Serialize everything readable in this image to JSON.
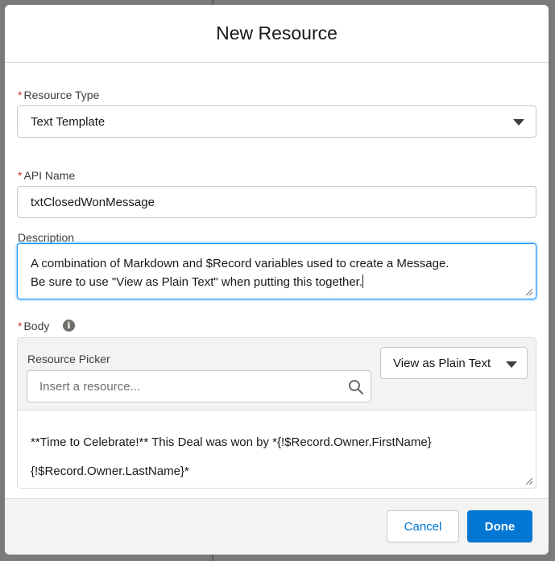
{
  "modal": {
    "title": "New Resource"
  },
  "resource_type": {
    "label": "Resource Type",
    "required_mark": "*",
    "value": "Text Template"
  },
  "api_name": {
    "label": "API Name",
    "required_mark": "*",
    "value": "txtClosedWonMessage"
  },
  "description": {
    "label": "Description",
    "lines": [
      "A combination of Markdown and $Record variables used to create a Message.",
      "Be sure to use \"View as Plain Text\" when putting this together."
    ]
  },
  "body": {
    "label": "Body",
    "required_mark": "*",
    "info_icon": "info-icon",
    "resource_picker": {
      "label": "Resource Picker",
      "placeholder": "Insert a resource...",
      "icon": "search-icon"
    },
    "view_mode": "View as Plain Text",
    "content_lines": [
      "**Time to Celebrate!** This Deal was won by *{!$Record.Owner.FirstName}",
      "{!$Record.Owner.LastName}*"
    ]
  },
  "footer": {
    "cancel_label": "Cancel",
    "done_label": "Done"
  },
  "colors": {
    "brand_blue": "#0176d3",
    "focus_blue": "#1b96ff",
    "required_red": "#c23934"
  }
}
